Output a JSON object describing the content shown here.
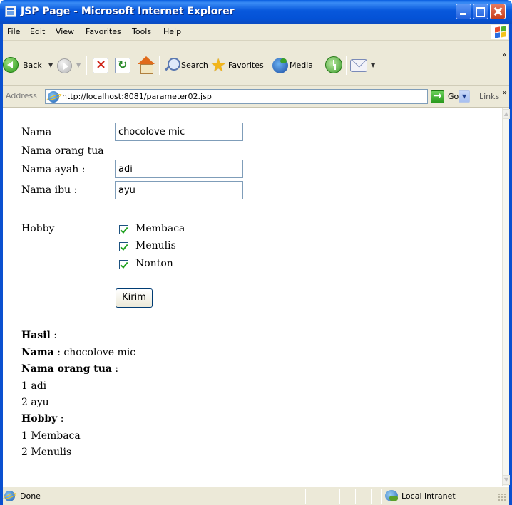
{
  "window": {
    "title": "JSP Page - Microsoft Internet Explorer"
  },
  "menu": {
    "items": [
      "File",
      "Edit",
      "View",
      "Favorites",
      "Tools",
      "Help"
    ]
  },
  "toolbar": {
    "back_label": "Back",
    "search_label": "Search",
    "favorites_label": "Favorites",
    "media_label": "Media"
  },
  "address": {
    "label": "Address",
    "url": "http://localhost:8081/parameter02.jsp",
    "go_label": "Go",
    "links_label": "Links"
  },
  "form": {
    "nama_label": "Nama",
    "nama_value": "chocolove mic",
    "orang_tua_label": "Nama orang tua",
    "ayah_label": "Nama ayah :",
    "ayah_value": "adi",
    "ibu_label": "Nama ibu :",
    "ibu_value": "ayu",
    "hobby_label": "Hobby",
    "hobbies": [
      {
        "label": "Membaca",
        "checked": true
      },
      {
        "label": "Menulis",
        "checked": true
      },
      {
        "label": "Nonton",
        "checked": true
      }
    ],
    "submit_label": "Kirim"
  },
  "result": {
    "hasil_label": "Hasil",
    "nama_label": "Nama",
    "nama_value": "chocolove mic",
    "orang_tua_label": "Nama orang tua",
    "orang_tua_values": [
      "1 adi",
      "2 ayu"
    ],
    "hobby_label": "Hobby",
    "hobby_values": [
      "1 Membaca",
      "2 Menulis"
    ]
  },
  "status": {
    "text": "Done",
    "zone": "Local intranet"
  },
  "colors": {
    "titlebar": "#0858dc",
    "chrome": "#ece9d8",
    "checkmark": "#21a121"
  }
}
